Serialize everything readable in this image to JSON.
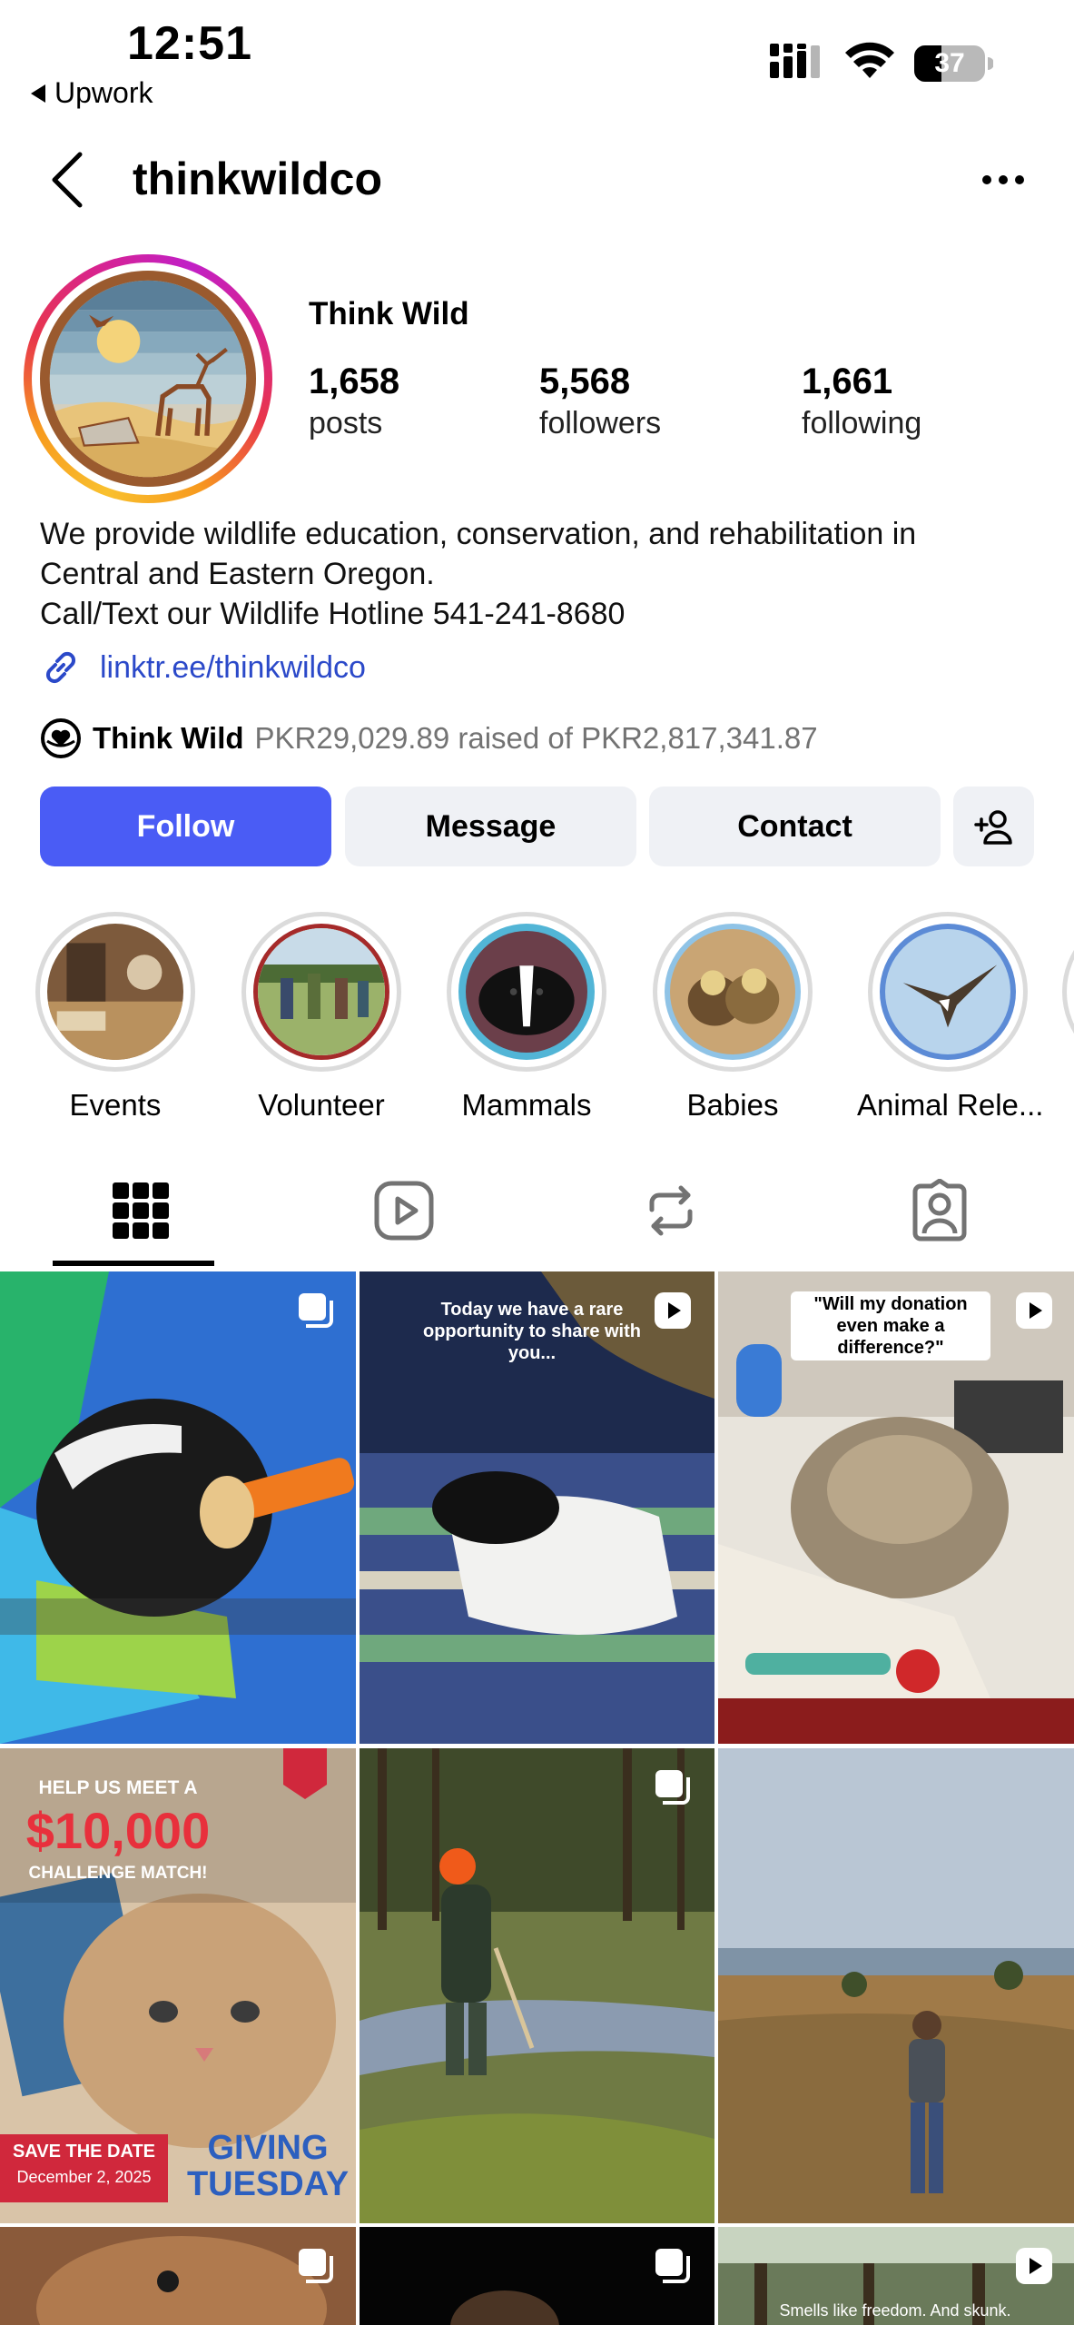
{
  "status_bar": {
    "time": "12:51",
    "back_app": "Upwork",
    "battery": "37"
  },
  "header": {
    "username": "thinkwildco"
  },
  "profile": {
    "display_name": "Think Wild",
    "stats": [
      {
        "value": "1,658",
        "label": "posts"
      },
      {
        "value": "5,568",
        "label": "followers"
      },
      {
        "value": "1,661",
        "label": "following"
      }
    ],
    "bio_lines": [
      "We provide wildlife education, conservation, and rehabilitation in",
      "Central and Eastern Oregon.",
      "Call/Text our Wildlife Hotline 541-241-8680"
    ],
    "link": "linktr.ee/thinkwildco",
    "fundraiser": {
      "org": "Think Wild",
      "amount": "PKR29,029.89 raised of PKR2,817,341.87"
    }
  },
  "buttons": {
    "follow": "Follow",
    "message": "Message",
    "contact": "Contact"
  },
  "highlights": [
    {
      "label": "Events"
    },
    {
      "label": "Volunteer"
    },
    {
      "label": "Mammals"
    },
    {
      "label": "Babies"
    },
    {
      "label": "Animal Rele..."
    }
  ],
  "tabs": [
    "grid-icon",
    "reels-icon",
    "reposts-icon",
    "tagged-icon"
  ],
  "posts": {
    "p2_caption": "Today we have a rare opportunity to share with you...",
    "p3_caption": "\"Will my donation even make a difference?\"",
    "p4_line1": "HELP US MEET A",
    "p4_amount": "$10,000",
    "p4_line2": "CHALLENGE MATCH!",
    "p4_save": "SAVE THE DATE",
    "p4_date": "December 2, 2025",
    "p4_gt1": "GIVING",
    "p4_gt2": "TUESDAY",
    "p9_caption": "Smells like freedom. And skunk."
  },
  "colors": {
    "follow_button": "#4a5cf5",
    "link": "#2b49c9",
    "secondary_button": "#eff1f5"
  }
}
